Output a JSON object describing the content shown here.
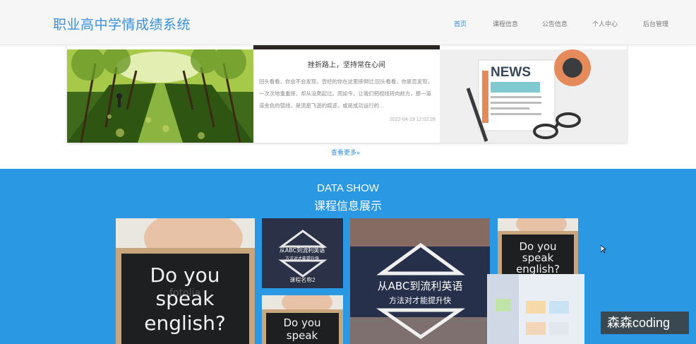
{
  "header": {
    "logo": "职业高中学情成绩系统",
    "nav": [
      "首页",
      "课程信息",
      "公告信息",
      "个人中心",
      "后台管理"
    ]
  },
  "news": {
    "title": "挫折路上，坚持常在心间",
    "body": "回头看看，你会不会发现，曾经的你在这里摔倒过;回头看看，你是否发现，一次次地重重摔，却从没爬起过。而如今，让我们把视线转向前方，那一道道金色的弧线，是流星飞逝的痕迹，或是成功运行的…",
    "time": "2022-04-19 12:02:28",
    "news_badge": "NEWS",
    "more": "查看更多"
  },
  "show": {
    "title": "DATA SHOW",
    "subtitle": "课程信息展示",
    "card_caption": "课程名称2",
    "board_text": [
      "Do you",
      "speak",
      "english?"
    ],
    "poster_line1": "从ABC到流利英语",
    "poster_line2": "方法对才能提升快",
    "board_watermark": "fotolia"
  },
  "watermark": "森森coding",
  "colors": {
    "accent": "#2f8ee0",
    "band": "#2b98e4"
  }
}
